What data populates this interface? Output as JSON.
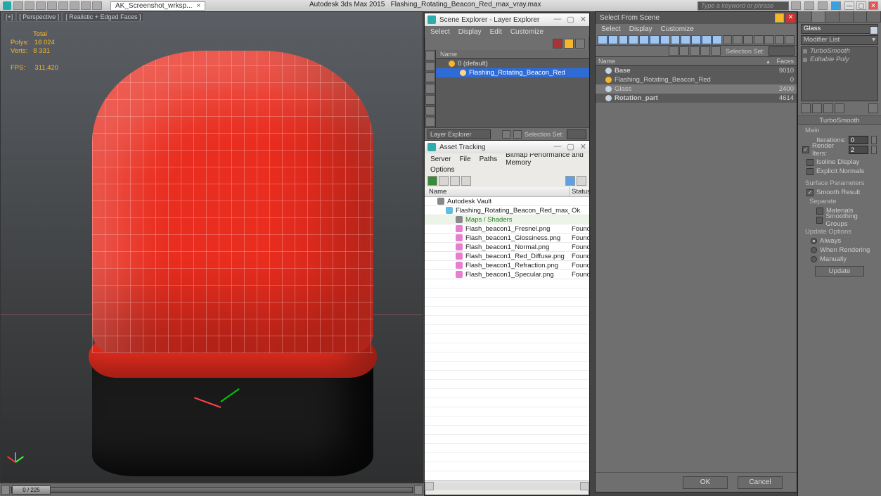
{
  "app_title": "Autodesk 3ds Max 2015",
  "scene_file": "Flashing_Rotating_Beacon_Red_max_vray.max",
  "workspace_tab": "AK_Screenshot_wrksp...",
  "search_placeholder": "Type a keyword or phrase",
  "viewport_label": {
    "plus": "[+]",
    "view": "[ Perspective ]",
    "shade": "[ Realistic + Edged Faces ]"
  },
  "stats": {
    "total_label": "Total",
    "polys_label": "Polys:",
    "polys": "16 024",
    "verts_label": "Verts:",
    "verts": "8 331",
    "fps_label": "FPS:",
    "fps": "311,420"
  },
  "time_slider": {
    "range": "0 / 225"
  },
  "scene_explorer": {
    "title": "Scene Explorer - Layer Explorer",
    "menu": [
      "Select",
      "Display",
      "Edit",
      "Customize"
    ],
    "header": "Name",
    "items": [
      {
        "label": "0 (default)",
        "indent": 0,
        "sel": false
      },
      {
        "label": "Flashing_Rotating_Beacon_Red",
        "indent": 1,
        "sel": true
      }
    ],
    "footer_combo": "Layer Explorer",
    "footer_label": "Selection Set:"
  },
  "asset_tracking": {
    "title": "Asset Tracking",
    "menu_line1": [
      "Server",
      "File",
      "Paths",
      "Bitmap Performance and Memory"
    ],
    "menu_line2": "Options",
    "header": {
      "name": "Name",
      "status": "Status"
    },
    "rows": [
      {
        "label": "Autodesk Vault",
        "status": "",
        "icon": "fold",
        "indent": 0,
        "cls": ""
      },
      {
        "label": "Flashing_Rotating_Beacon_Red_max_vray.max",
        "status": "Ok",
        "icon": "mx",
        "indent": 1,
        "cls": ""
      },
      {
        "label": "Maps / Shaders",
        "status": "",
        "icon": "fold",
        "indent": 2,
        "cls": "grp"
      },
      {
        "label": "Flash_beacon1_Fresnel.png",
        "status": "Found",
        "icon": "img",
        "indent": 2,
        "cls": ""
      },
      {
        "label": "Flash_beacon1_Glossiness.png",
        "status": "Found",
        "icon": "img",
        "indent": 2,
        "cls": ""
      },
      {
        "label": "Flash_beacon1_Normal.png",
        "status": "Found",
        "icon": "img",
        "indent": 2,
        "cls": ""
      },
      {
        "label": "Flash_beacon1_Red_Diffuse.png",
        "status": "Found",
        "icon": "img",
        "indent": 2,
        "cls": ""
      },
      {
        "label": "Flash_beacon1_Refraction.png",
        "status": "Found",
        "icon": "img",
        "indent": 2,
        "cls": ""
      },
      {
        "label": "Flash_beacon1_Specular.png",
        "status": "Found",
        "icon": "img",
        "indent": 2,
        "cls": ""
      }
    ]
  },
  "select_from_scene": {
    "title": "Select From Scene",
    "menu": [
      "Select",
      "Display",
      "Customize"
    ],
    "sel_set_label": "Selection Set:",
    "header": {
      "name": "Name",
      "faces": "Faces"
    },
    "rows": [
      {
        "label": "Base",
        "faces": "9010",
        "color": "#c7d3e0",
        "sel": false,
        "bold": true
      },
      {
        "label": "Flashing_Rotating_Beacon_Red",
        "faces": "0",
        "color": "#f7b52c",
        "sel": false,
        "bold": false
      },
      {
        "label": "Glass",
        "faces": "2400",
        "color": "#c7d3e0",
        "sel": true,
        "bold": false
      },
      {
        "label": "Rotation_part",
        "faces": "4614",
        "color": "#c7d3e0",
        "sel": false,
        "bold": true
      }
    ],
    "ok": "OK",
    "cancel": "Cancel"
  },
  "command_panel": {
    "obj_name": "Glass",
    "modlist_label": "Modifier List",
    "stack": [
      "TurboSmooth",
      "Editable Poly"
    ],
    "rollout_title": "TurboSmooth",
    "main_label": "Main",
    "iterations": {
      "label": "Iterations:",
      "value": "0"
    },
    "render_iters": {
      "label": "Render Iters:",
      "value": "2",
      "checked": true
    },
    "isoline": {
      "label": "Isoline Display",
      "checked": false
    },
    "explicit": {
      "label": "Explicit Normals",
      "checked": false
    },
    "surface_label": "Surface Parameters",
    "smooth_result": {
      "label": "Smooth Result",
      "checked": true
    },
    "separate_label": "Separate",
    "sep_materials": {
      "label": "Materials",
      "checked": false
    },
    "sep_smoothing": {
      "label": "Smoothing Groups",
      "checked": false
    },
    "update_label": "Update Options",
    "upd_always": "Always",
    "upd_render": "When Rendering",
    "upd_manual": "Manually",
    "update_btn": "Update"
  }
}
